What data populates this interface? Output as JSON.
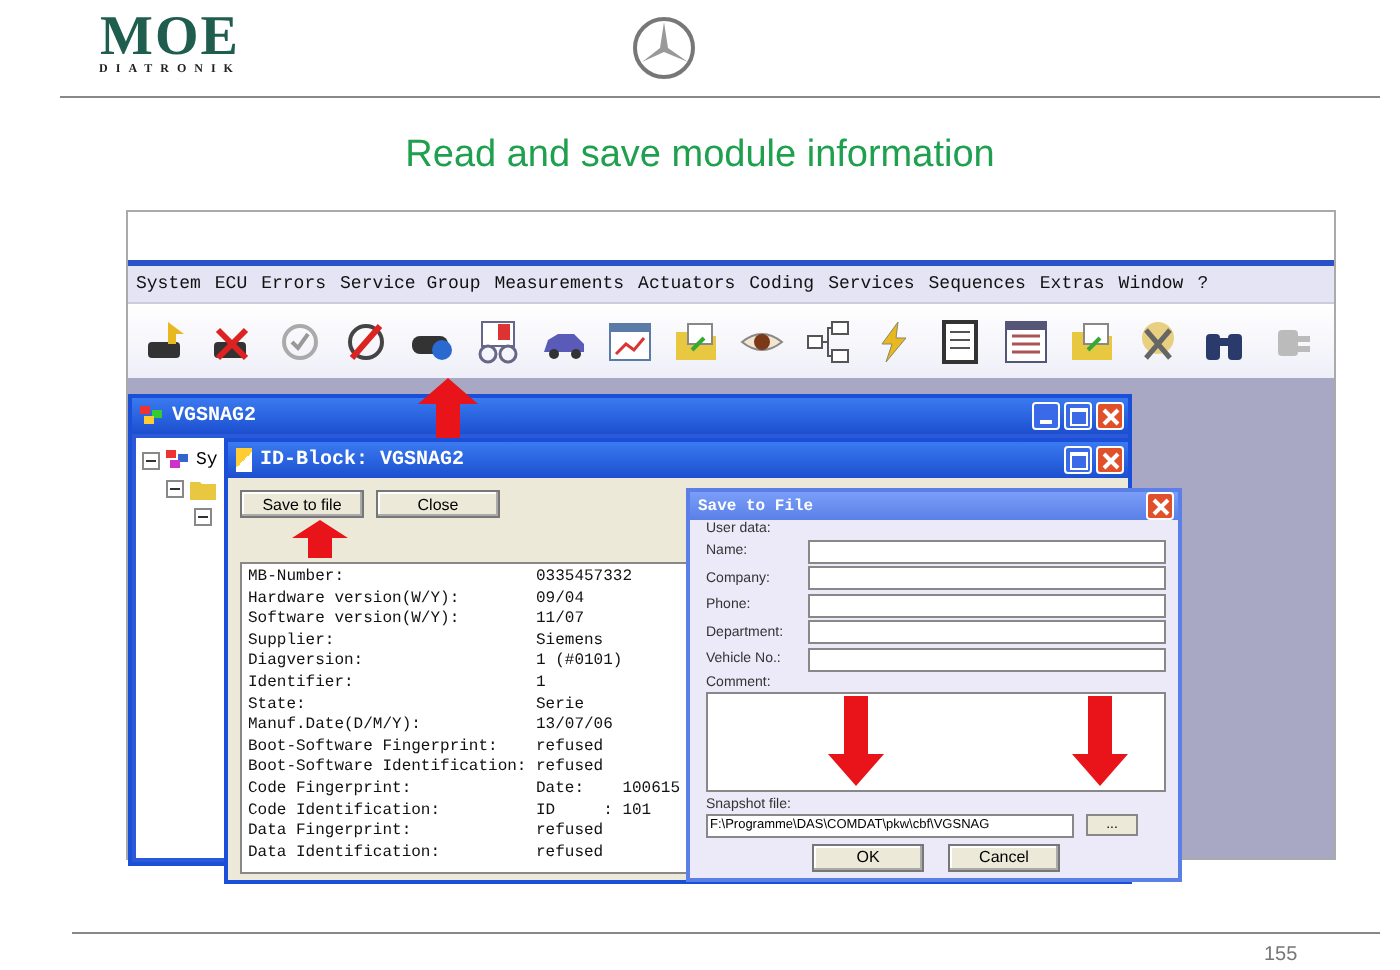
{
  "header": {
    "logo": "MOE",
    "logo_subtitle": "DIATRONIK"
  },
  "title": "Read and save module information",
  "app": {
    "menu": [
      "System",
      "ECU",
      "Errors",
      "Service Group",
      "Measurements",
      "Actuators",
      "Coding",
      "Services",
      "Sequences",
      "Extras",
      "Window",
      "?"
    ],
    "main_window": {
      "title": "VGSNAG2",
      "tree_root": "Sy"
    },
    "id_block": {
      "title": "ID-Block: VGSNAG2",
      "buttons": [
        "Save to file",
        "Close"
      ],
      "rows": [
        {
          "label": "MB-Number:",
          "value": "0335457332"
        },
        {
          "label": "Hardware version(W/Y):",
          "value": "09/04"
        },
        {
          "label": "Software version(W/Y):",
          "value": "11/07"
        },
        {
          "label": "Supplier:",
          "value": "Siemens"
        },
        {
          "label": "Diagversion:",
          "value": "1 (#0101)"
        },
        {
          "label": "Identifier:",
          "value": "1"
        },
        {
          "label": "State:",
          "value": "Serie"
        },
        {
          "label": "Manuf.Date(D/M/Y):",
          "value": "13/07/06"
        },
        {
          "label": "Boot-Software Fingerprint:",
          "value": "refused"
        },
        {
          "label": "Boot-Software Identification:",
          "value": "refused"
        },
        {
          "label": "Code Fingerprint:",
          "value": "Date:    100615"
        },
        {
          "label": "Code Identification:",
          "value": "ID     : 101"
        },
        {
          "label": "Data Fingerprint:",
          "value": "refused"
        },
        {
          "label": "Data Identification:",
          "value": "refused"
        }
      ]
    },
    "save_dialog": {
      "title": "Save to File",
      "section": "User data:",
      "fields": [
        {
          "label": "Name:"
        },
        {
          "label": "Company:"
        },
        {
          "label": "Phone:"
        },
        {
          "label": "Department:"
        },
        {
          "label": "Vehicle No.:"
        }
      ],
      "comment_label": "Comment:",
      "snapshot_label": "Snapshot file:",
      "snapshot_value": "F:\\Programme\\DAS\\COMDAT\\pkw\\cbf\\VGSNAG",
      "browse": "...",
      "buttons": [
        "OK",
        "Cancel"
      ]
    }
  },
  "page_number": "155"
}
